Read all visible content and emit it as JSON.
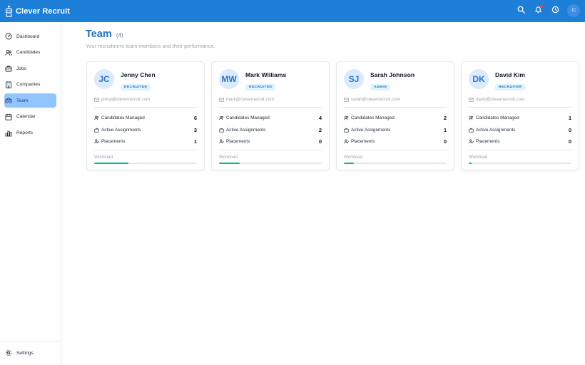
{
  "app": {
    "name": "Clever Recruit",
    "user_initials": "JC",
    "brand_color": "#1e7fd8",
    "icons": {
      "logo": "robot-icon",
      "search": "search-icon",
      "notifications": "bell-icon",
      "recent": "clock-icon"
    },
    "has_unread_notifications": true
  },
  "sidebar": {
    "items": [
      {
        "label": "Dashboard",
        "icon": "dashboard-icon",
        "active": false
      },
      {
        "label": "Candidates",
        "icon": "users-icon",
        "active": false
      },
      {
        "label": "Jobs",
        "icon": "briefcase-icon",
        "active": false
      },
      {
        "label": "Companies",
        "icon": "building-icon",
        "active": false
      },
      {
        "label": "Team",
        "icon": "team-icon",
        "active": true
      },
      {
        "label": "Calendar",
        "icon": "calendar-icon",
        "active": false
      },
      {
        "label": "Reports",
        "icon": "bar-chart-icon",
        "active": false
      }
    ],
    "settings_label": "Settings"
  },
  "page": {
    "title": "Team",
    "count": "(4)",
    "subtitle": "Your recruitment team members and their performance."
  },
  "stat_labels": {
    "candidates": "Candidates Managed",
    "assignments": "Active Assignments",
    "placements": "Placements",
    "workload": "Workload"
  },
  "members": [
    {
      "initials": "JC",
      "name": "Jenny Chen",
      "role": "RECRUITER",
      "email": "jenny@cleverrecruit.com",
      "candidates": "6",
      "assignments": "3",
      "placements": "1",
      "workload": 0.33
    },
    {
      "initials": "MW",
      "name": "Mark Williams",
      "role": "RECRUITER",
      "email": "mark@cleverrecruit.com",
      "candidates": "4",
      "assignments": "2",
      "placements": "0",
      "workload": 0.2
    },
    {
      "initials": "SJ",
      "name": "Sarah Johnson",
      "role": "ADMIN",
      "email": "sarah@cleverrecruit.com",
      "candidates": "2",
      "assignments": "1",
      "placements": "0",
      "workload": 0.1
    },
    {
      "initials": "DK",
      "name": "David Kim",
      "role": "RECRUITER",
      "email": "david@cleverrecruit.com",
      "candidates": "1",
      "assignments": "0",
      "placements": "0",
      "workload": 0.03
    }
  ]
}
